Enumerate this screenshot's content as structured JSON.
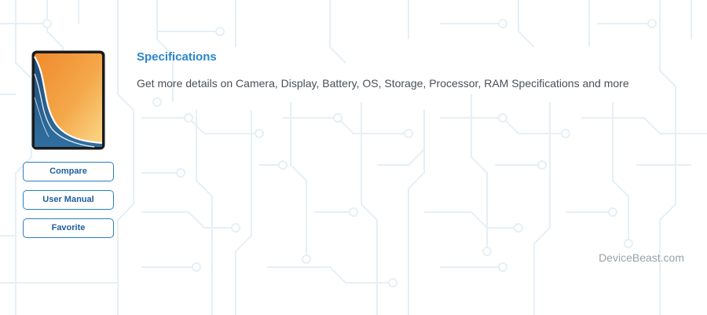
{
  "device": {
    "image_alt": "Device image"
  },
  "actions": {
    "compare_label": "Compare",
    "user_manual_label": "User Manual",
    "favorite_label": "Favorite"
  },
  "section": {
    "title": "Specifications",
    "description": "Get more details on Camera, Display, Battery, OS, Storage, Processor, RAM Specifications and more"
  },
  "brand": {
    "watermark": "DeviceBeast.com"
  },
  "colors": {
    "accent": "#2a88c9",
    "button_border": "#2a7fc1",
    "body_text": "#4a4f55",
    "watermark_text": "#9aa1a8",
    "pattern_line": "#e4eef5"
  }
}
